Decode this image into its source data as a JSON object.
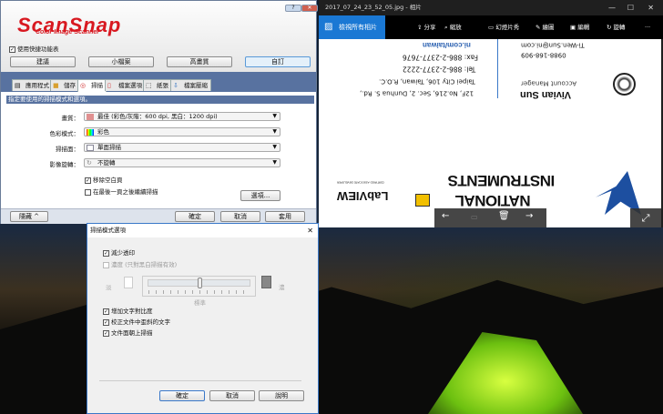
{
  "scansnap": {
    "logo": "ScanSnap",
    "logo_sub": "Color Image Scanner",
    "title_help": "?",
    "title_close": "✕",
    "quick_menu_label": "使用快捷功能表",
    "presets": [
      "建議",
      "小檔案",
      "高畫質",
      "自訂"
    ],
    "tabs": [
      "應用程式",
      "儲存",
      "掃描",
      "檔案選項",
      "紙張",
      "檔案壓縮"
    ],
    "section_header": "指定要使用的掃描模式和選項。",
    "fields": [
      {
        "label": "畫質：",
        "value": "最佳 (彩色/灰階：600 dpi, 黑白：1200 dpi)"
      },
      {
        "label": "色彩模式：",
        "value": "彩色"
      },
      {
        "label": "掃描面：",
        "value": "單面掃描"
      },
      {
        "label": "影像旋轉：",
        "value": "不旋轉"
      }
    ],
    "remove_blank": "移除空白頁",
    "remove_blank_checked": true,
    "continue_scan": "在最後一頁之後繼續掃描",
    "continue_scan_checked": false,
    "options_btn": "選項...",
    "hide_btn": "隱藏 ^",
    "ok": "確定",
    "cancel": "取消",
    "apply": "套用"
  },
  "dialog": {
    "title": "掃描模式選項",
    "close": "✕",
    "reduce_bleed": "減少透印",
    "reduce_bleed_checked": true,
    "density": "濃度 (只對黑白掃描有效)",
    "density_checked": false,
    "light": "淡",
    "dark": "濃",
    "standard": "標準",
    "slider_fraction": 0.5,
    "text_contrast": "增加文字對比度",
    "correct_skew": "校正文件中歪斜的文字",
    "face_up": "文件面朝上掃描",
    "ok": "確定",
    "cancel": "取消",
    "help": "說明"
  },
  "photos": {
    "title": "2017_07_24_23_52_05.jpg - 相片",
    "back": "檢視所有相片",
    "actions": [
      "分享",
      "縮放",
      "幻燈片秀",
      "繪圖",
      "編輯",
      "旋轉"
    ],
    "more": "···",
    "card": {
      "name": "Vivian Sun",
      "role": "Account Manager",
      "mobile": "0988-168-909",
      "email": "Ti-Wen.Sun@ni.com",
      "addr1": "12F, No.216, Sec. 2, Dunhua S. Rd.,",
      "addr2": "Taipei City 106, Taiwan, R.O.C.",
      "tel": "Tel: 886-2-2377-2222",
      "fax": "Fax: 886-2-2377-7676",
      "web": "ni.com/taiwan",
      "brand1": "NATIONAL",
      "brand2": "INSTRUMENTS",
      "labview": "LabVIEW",
      "labview_sub": "CERTIFIED ASSOCIATE DEVELOPER"
    }
  }
}
